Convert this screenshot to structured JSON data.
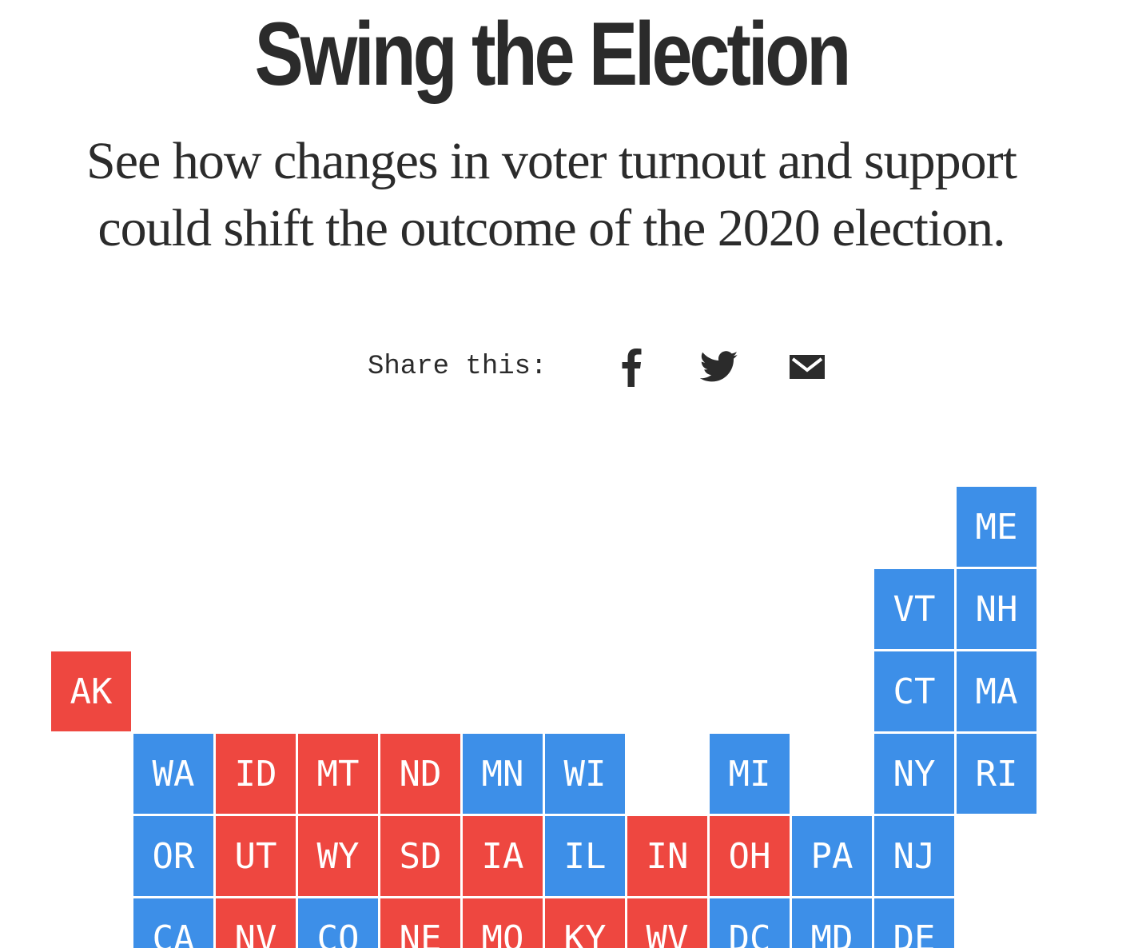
{
  "header": {
    "title": "Swing the Election",
    "subtitle": "See how changes in voter turnout and support could shift the outcome of the 2020 election."
  },
  "share": {
    "label": "Share this:",
    "buttons": [
      {
        "name": "facebook",
        "icon": "facebook-icon"
      },
      {
        "name": "twitter",
        "icon": "twitter-icon"
      },
      {
        "name": "email",
        "icon": "email-icon"
      }
    ]
  },
  "colors": {
    "democrat": "#3d8fe8",
    "republican": "#ee4740",
    "text": "#2b2b2b"
  },
  "map": {
    "tiles": [
      {
        "state": "ME",
        "party": "democrat",
        "col": 11,
        "row": 0
      },
      {
        "state": "VT",
        "party": "democrat",
        "col": 10,
        "row": 1
      },
      {
        "state": "NH",
        "party": "democrat",
        "col": 11,
        "row": 1
      },
      {
        "state": "AK",
        "party": "republican",
        "col": 0,
        "row": 2
      },
      {
        "state": "CT",
        "party": "democrat",
        "col": 10,
        "row": 2
      },
      {
        "state": "MA",
        "party": "democrat",
        "col": 11,
        "row": 2
      },
      {
        "state": "WA",
        "party": "democrat",
        "col": 1,
        "row": 3
      },
      {
        "state": "ID",
        "party": "republican",
        "col": 2,
        "row": 3
      },
      {
        "state": "MT",
        "party": "republican",
        "col": 3,
        "row": 3
      },
      {
        "state": "ND",
        "party": "republican",
        "col": 4,
        "row": 3
      },
      {
        "state": "MN",
        "party": "democrat",
        "col": 5,
        "row": 3
      },
      {
        "state": "WI",
        "party": "democrat",
        "col": 6,
        "row": 3
      },
      {
        "state": "MI",
        "party": "democrat",
        "col": 8,
        "row": 3
      },
      {
        "state": "NY",
        "party": "democrat",
        "col": 10,
        "row": 3
      },
      {
        "state": "RI",
        "party": "democrat",
        "col": 11,
        "row": 3
      },
      {
        "state": "OR",
        "party": "democrat",
        "col": 1,
        "row": 4
      },
      {
        "state": "UT",
        "party": "republican",
        "col": 2,
        "row": 4
      },
      {
        "state": "WY",
        "party": "republican",
        "col": 3,
        "row": 4
      },
      {
        "state": "SD",
        "party": "republican",
        "col": 4,
        "row": 4
      },
      {
        "state": "IA",
        "party": "republican",
        "col": 5,
        "row": 4
      },
      {
        "state": "IL",
        "party": "democrat",
        "col": 6,
        "row": 4
      },
      {
        "state": "IN",
        "party": "republican",
        "col": 7,
        "row": 4
      },
      {
        "state": "OH",
        "party": "republican",
        "col": 8,
        "row": 4
      },
      {
        "state": "PA",
        "party": "democrat",
        "col": 9,
        "row": 4
      },
      {
        "state": "NJ",
        "party": "democrat",
        "col": 10,
        "row": 4
      },
      {
        "state": "CA",
        "party": "democrat",
        "col": 1,
        "row": 5
      },
      {
        "state": "NV",
        "party": "republican",
        "col": 2,
        "row": 5
      },
      {
        "state": "CO",
        "party": "democrat",
        "col": 3,
        "row": 5
      },
      {
        "state": "NE",
        "party": "republican",
        "col": 4,
        "row": 5
      },
      {
        "state": "MO",
        "party": "republican",
        "col": 5,
        "row": 5
      },
      {
        "state": "KY",
        "party": "republican",
        "col": 6,
        "row": 5
      },
      {
        "state": "WV",
        "party": "republican",
        "col": 7,
        "row": 5
      },
      {
        "state": "DC",
        "party": "democrat",
        "col": 8,
        "row": 5
      },
      {
        "state": "MD",
        "party": "democrat",
        "col": 9,
        "row": 5
      },
      {
        "state": "DE",
        "party": "democrat",
        "col": 10,
        "row": 5
      }
    ]
  }
}
